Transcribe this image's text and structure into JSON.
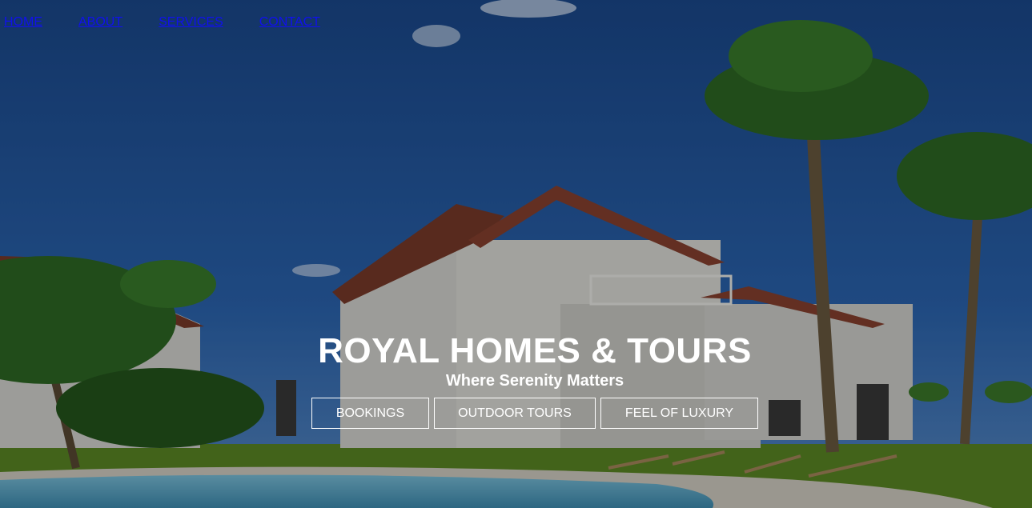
{
  "nav": {
    "items": [
      {
        "label": "HOME"
      },
      {
        "label": "ABOUT"
      },
      {
        "label": "SERVICES"
      },
      {
        "label": "CONTACT"
      }
    ]
  },
  "hero": {
    "title": "ROYAL HOMES & TOURS",
    "subtitle": "Where Serenity Matters",
    "buttons": [
      {
        "label": "BOOKINGS"
      },
      {
        "label": "OUTDOOR TOURS"
      },
      {
        "label": "FEEL OF LUXURY"
      }
    ]
  },
  "colors": {
    "link": "#1010ee",
    "text": "#ffffff",
    "sky": "#1c4f96",
    "wall": "#cfcfcf",
    "roof": "#7a3a2a",
    "pool": "#5fa9c9",
    "grass": "#5a8a23"
  }
}
